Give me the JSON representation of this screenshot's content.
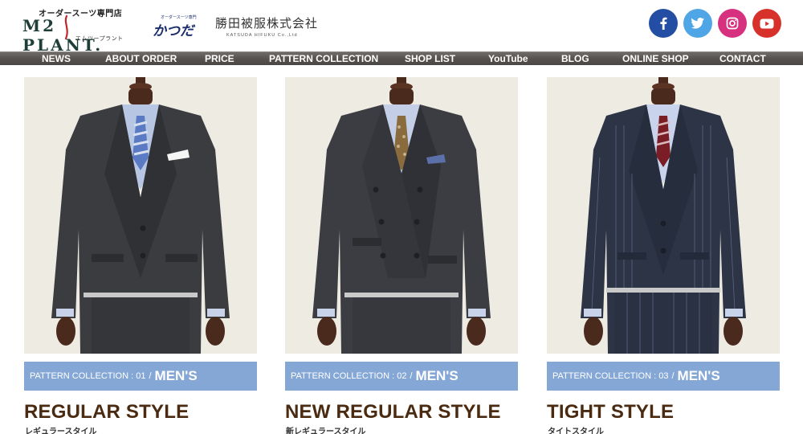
{
  "header": {
    "brand": {
      "tagline": "オーダースーツ専門店",
      "mark": "M2 PLANT.",
      "kana": "エムツープラント"
    },
    "partner_logo": {
      "small": "オーダースーツ専門",
      "big": "かつだ"
    },
    "company": {
      "name_jp": "勝田被服株式会社",
      "name_en": "KATSUDA HIFUKU Co.,Ltd"
    },
    "social": [
      {
        "name": "facebook",
        "icon": "facebook-icon",
        "color": "#234ea3"
      },
      {
        "name": "twitter",
        "icon": "twitter-icon",
        "color": "#4ea6e6"
      },
      {
        "name": "instagram",
        "icon": "instagram-icon",
        "color": "#d7307e"
      },
      {
        "name": "youtube",
        "icon": "youtube-icon",
        "color": "#d7312c"
      }
    ]
  },
  "nav": {
    "items": [
      {
        "label": "NEWS"
      },
      {
        "label": "ABOUT ORDER"
      },
      {
        "label": "PRICE"
      },
      {
        "label": "PATTERN COLLECTION"
      },
      {
        "label": "SHOP LIST"
      },
      {
        "label": "YouTube"
      },
      {
        "label": "BLOG"
      },
      {
        "label": "ONLINE SHOP"
      },
      {
        "label": "CONTACT"
      }
    ]
  },
  "cards": [
    {
      "collection_label": "PATTERN COLLECTION : 01",
      "separator": "/",
      "category": "MEN'S",
      "title": "REGULAR STYLE",
      "subtitle": "レギュラースタイル",
      "suit_color": "#3a3c40",
      "tie": "blue stripe"
    },
    {
      "collection_label": "PATTERN COLLECTION : 02",
      "separator": "/",
      "category": "MEN'S",
      "title": "NEW REGULAR STYLE",
      "subtitle": "新レギュラースタイル",
      "suit_color": "#3b3d42",
      "tie": "brown paisley"
    },
    {
      "collection_label": "PATTERN COLLECTION : 03",
      "separator": "/",
      "category": "MEN'S",
      "title": "TIGHT STYLE",
      "subtitle": "タイトスタイル",
      "suit_color": "#2c3446",
      "tie": "red stripe"
    }
  ],
  "colors": {
    "accent_bar": "#85a7d6",
    "title_brown": "#4a2a10",
    "nav_bg": "#57524f",
    "photo_bg": "#eeebe3"
  }
}
